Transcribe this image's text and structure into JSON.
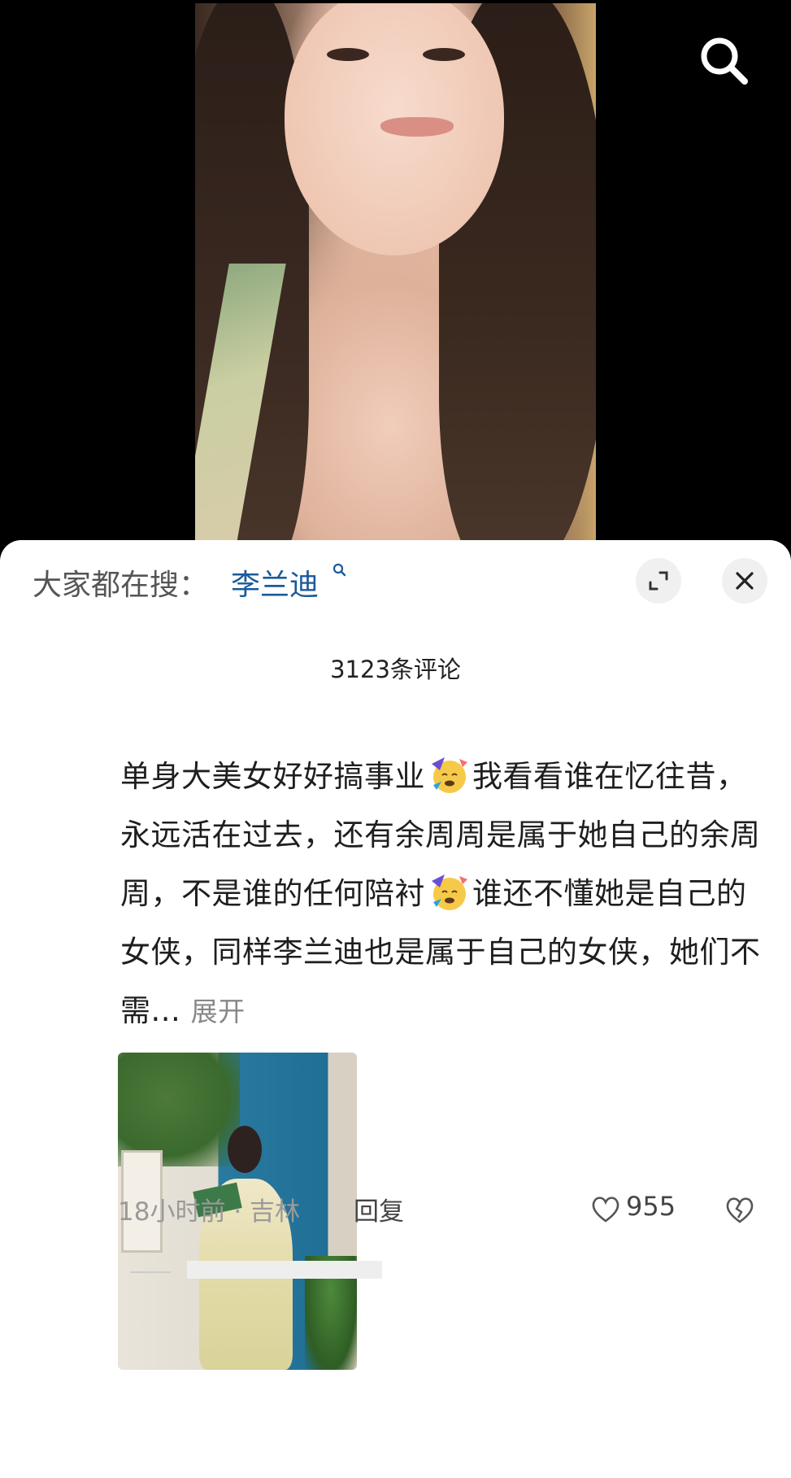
{
  "header": {
    "everyone_searching_label": "大家都在搜：",
    "everyone_searching_term": "李兰迪"
  },
  "comments": {
    "count_label": "3123条评论",
    "items": [
      {
        "text_part1": "单身大美女好好搞事业",
        "text_part2": "我看看谁在忆往昔，永远活在过去，还有余周周是属于她自己的余周周，不是谁的任何陪衬",
        "text_part3": "谁还不懂她是自己的女侠，同样李兰迪也是属于自己的女侠，她们不需...",
        "expand_label": "展开",
        "time": "18小时前",
        "separator": "·",
        "location": "吉林",
        "reply_label": "回复",
        "likes": "955",
        "emoji_icon": "partying-face-icon"
      }
    ]
  },
  "colors": {
    "search_term": "#1a5a9a",
    "background": "#ffffff",
    "meta_text": "#999999"
  }
}
